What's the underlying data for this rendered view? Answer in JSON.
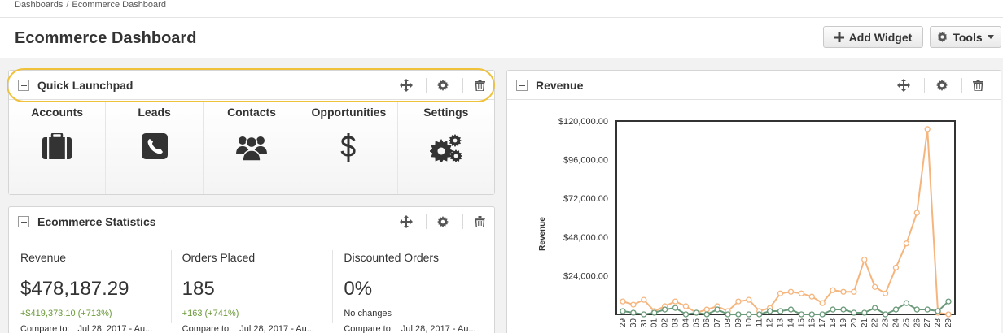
{
  "breadcrumb": {
    "items": [
      "Dashboards",
      "Ecommerce Dashboard"
    ],
    "separator": "/"
  },
  "header": {
    "title": "Ecommerce Dashboard",
    "add_widget_label": "Add Widget",
    "tools_label": "Tools"
  },
  "launchpad": {
    "title": "Quick Launchpad",
    "items": [
      {
        "label": "Accounts",
        "icon": "briefcase-icon"
      },
      {
        "label": "Leads",
        "icon": "phone-icon"
      },
      {
        "label": "Contacts",
        "icon": "people-icon"
      },
      {
        "label": "Opportunities",
        "icon": "dollar-icon"
      },
      {
        "label": "Settings",
        "icon": "gears-icon"
      }
    ]
  },
  "stats": {
    "title": "Ecommerce Statistics",
    "items": [
      {
        "label": "Revenue",
        "value": "$478,187.29",
        "delta": "+$419,373.10 (+713%)",
        "compare_label": "Compare to:",
        "compare_value": "Jul 28, 2017 - Au..."
      },
      {
        "label": "Orders Placed",
        "value": "185",
        "delta": "+163 (+741%)",
        "compare_label": "Compare to:",
        "compare_value": "Jul 28, 2017 - Au..."
      },
      {
        "label": "Discounted Orders",
        "value": "0%",
        "delta": "No changes",
        "compare_label": "Compare to:",
        "compare_value": "Jul 28, 2017 - Au..."
      }
    ]
  },
  "revenue_widget": {
    "title": "Revenue"
  },
  "colors": {
    "accent": "#f0c23b",
    "series_primary": "#f5b57e",
    "series_secondary": "#6a9a79",
    "positive": "#6c9a3a"
  },
  "chart_data": {
    "type": "line",
    "title": "",
    "xlabel": "",
    "ylabel": "Revenue",
    "ylim": [
      0,
      120000
    ],
    "yticks": [
      "$24,000.00",
      "$48,000.00",
      "$72,000.00",
      "$96,000.00",
      "$120,000.00"
    ],
    "ytick_values": [
      24000,
      48000,
      72000,
      96000,
      120000
    ],
    "categories": [
      "29",
      "30",
      "31",
      "01",
      "02",
      "03",
      "04",
      "05",
      "06",
      "07",
      "08",
      "09",
      "10",
      "11",
      "12",
      "13",
      "14",
      "15",
      "16",
      "17",
      "18",
      "19",
      "20",
      "21",
      "22",
      "23",
      "24",
      "25",
      "26",
      "27",
      "28",
      "29"
    ],
    "series": [
      {
        "values": [
          8000,
          6000,
          9000,
          2000,
          5000,
          8000,
          5000,
          1000,
          3000,
          5000,
          2000,
          8000,
          9000,
          2000,
          4000,
          13000,
          14000,
          13000,
          11000,
          7000,
          15000,
          14000,
          14000,
          34000,
          17000,
          13000,
          29000,
          44000,
          63000,
          115000,
          1000,
          0
        ]
      },
      {
        "values": [
          2000,
          1000,
          0,
          1000,
          3000,
          4000,
          0,
          1000,
          0,
          3000,
          0,
          0,
          0,
          0,
          2000,
          2000,
          3000,
          0,
          0,
          0,
          3000,
          3000,
          1000,
          1000,
          4000,
          0,
          3000,
          7000,
          3000,
          3000,
          2000,
          8000
        ]
      }
    ]
  }
}
